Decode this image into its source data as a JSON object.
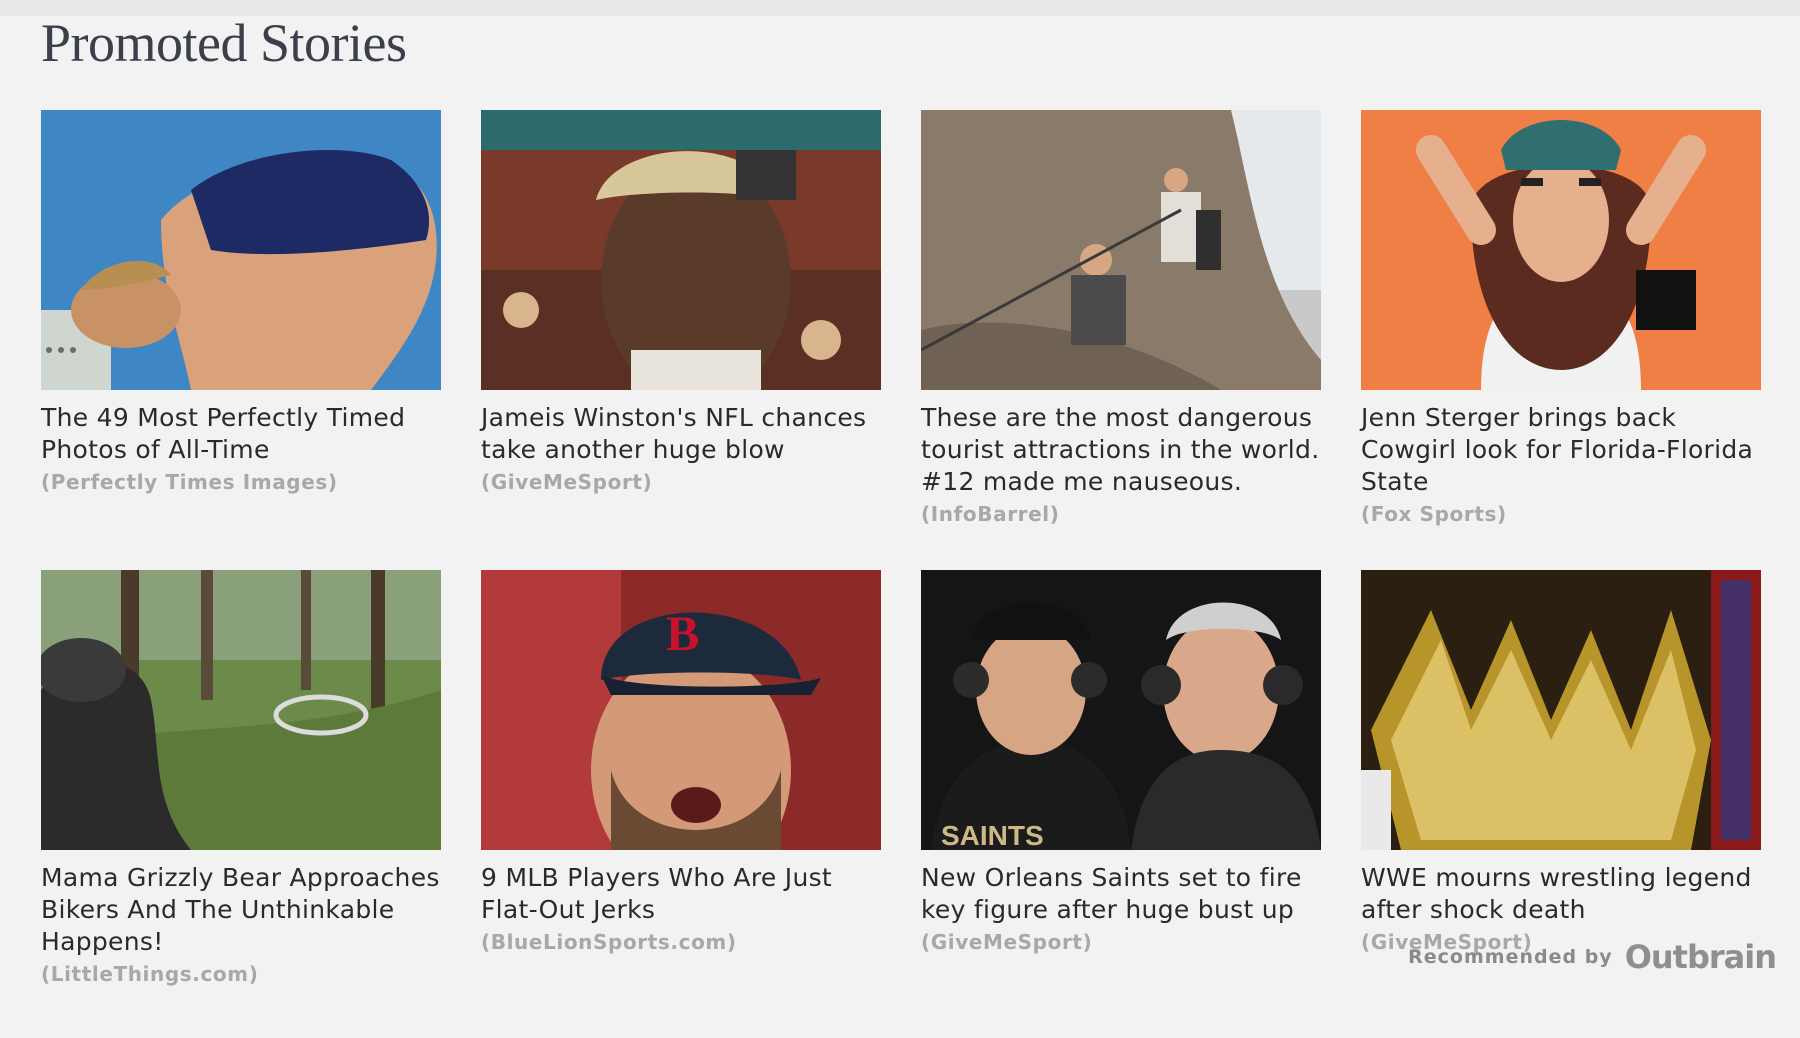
{
  "section": {
    "title": "Promoted Stories"
  },
  "stories": [
    {
      "title": "The 49 Most Perfectly Timed Photos of All-Time",
      "source": "(Perfectly Times Images)"
    },
    {
      "title": "Jameis Winston's NFL chances take another huge blow",
      "source": "(GiveMeSport)"
    },
    {
      "title": "These are the most dangerous tourist attractions in the world. #12 made me nauseous.",
      "source": "(InfoBarrel)"
    },
    {
      "title": "Jenn Sterger brings back Cowgirl look for Florida-Florida State",
      "source": "(Fox Sports)"
    },
    {
      "title": "Mama Grizzly Bear Approaches Bikers And The Unthinkable Happens!",
      "source": "(LittleThings.com)"
    },
    {
      "title": "9 MLB Players Who Are Just Flat-Out Jerks",
      "source": "(BlueLionSports.com)"
    },
    {
      "title": "New Orleans Saints set to fire key figure after huge bust up",
      "source": "(GiveMeSport)"
    },
    {
      "title": "WWE mourns wrestling legend after shock death",
      "source": "(GiveMeSport)"
    }
  ],
  "footer": {
    "recommended_label": "Recommended by",
    "logo_text": "Outbrain"
  }
}
